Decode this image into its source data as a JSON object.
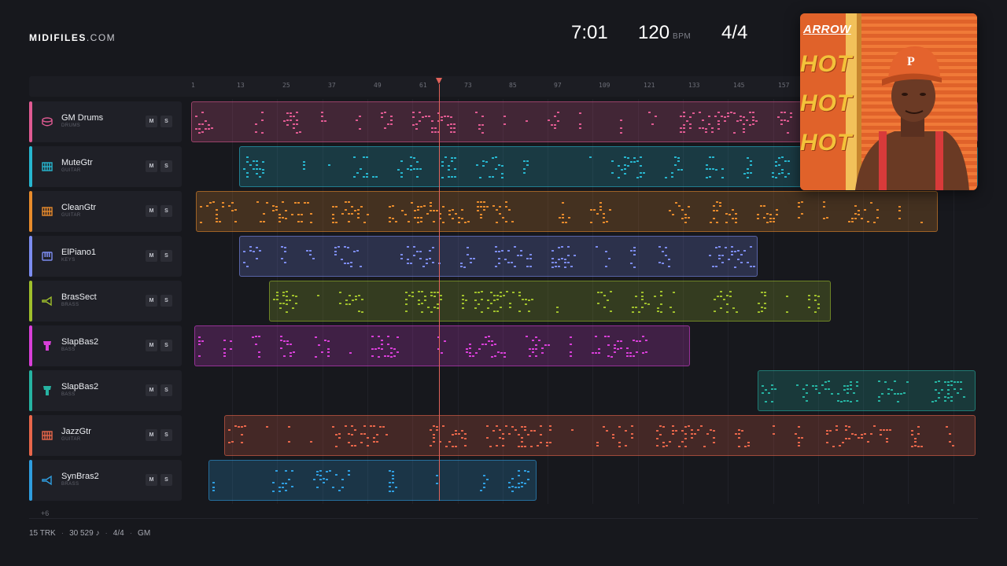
{
  "header": {
    "logo_brand": "MIDIFILES",
    "logo_domain": ".COM",
    "duration": "7:01",
    "tempo": "120",
    "tempo_unit": "BPM",
    "time_signature": "4/4"
  },
  "ruler": {
    "ticks": [
      "1",
      "13",
      "25",
      "37",
      "49",
      "61",
      "73",
      "85",
      "97",
      "109",
      "121",
      "133",
      "145",
      "157"
    ]
  },
  "tracks": [
    {
      "name": "GM Drums",
      "category": "DRUMS",
      "color": "#e05a92",
      "icon": "drum-icon",
      "mute": "M",
      "solo": "S"
    },
    {
      "name": "MuteGtr",
      "category": "GUITAR",
      "color": "#27b6cf",
      "icon": "guitar-fretboard-icon",
      "mute": "M",
      "solo": "S"
    },
    {
      "name": "CleanGtr",
      "category": "GUITAR",
      "color": "#e88b2c",
      "icon": "guitar-fretboard-icon",
      "mute": "M",
      "solo": "S"
    },
    {
      "name": "ElPiano1",
      "category": "KEYS",
      "color": "#7c8cf0",
      "icon": "piano-keys-icon",
      "mute": "M",
      "solo": "S"
    },
    {
      "name": "BrasSect",
      "category": "BRASS",
      "color": "#9fbf2c",
      "icon": "horn-icon",
      "mute": "M",
      "solo": "S"
    },
    {
      "name": "SlapBas2",
      "category": "BASS",
      "color": "#d83fd8",
      "icon": "bass-amp-icon",
      "mute": "M",
      "solo": "S"
    },
    {
      "name": "SlapBas2",
      "category": "BASS",
      "color": "#26b3a2",
      "icon": "bass-amp-icon",
      "mute": "M",
      "solo": "S"
    },
    {
      "name": "JazzGtr",
      "category": "GUITAR",
      "color": "#e8664a",
      "icon": "guitar-fretboard-icon",
      "mute": "M",
      "solo": "S"
    },
    {
      "name": "SynBras2",
      "category": "BRASS",
      "color": "#2f9ee0",
      "icon": "horn-icon",
      "mute": "M",
      "solo": "S"
    }
  ],
  "more_tracks": "+6",
  "footer": {
    "tracks": "15 TRK",
    "notes": "30 529 ♪",
    "time_signature": "4/4",
    "standard": "GM"
  },
  "album": {
    "artist": "ARROW",
    "title_lines": [
      "HOT",
      "HOT",
      "HOT"
    ]
  }
}
